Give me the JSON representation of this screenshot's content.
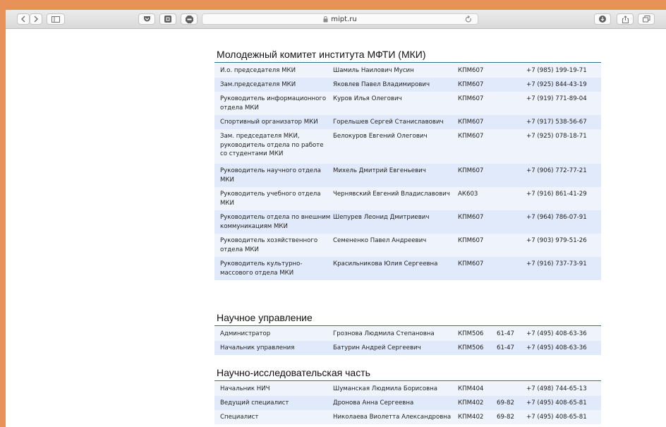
{
  "browser": {
    "url": "mipt.ru"
  },
  "sections": [
    {
      "title": "Молодежный комитет института МФТИ (МКИ)",
      "rows": [
        {
          "role": "И.о. председателя МКИ",
          "name": "Шамиль Наилович Мусин",
          "room": "КПМ607",
          "ext": "",
          "phone": "+7 (985) 199-19-71"
        },
        {
          "role": "Зам.председателя МКИ",
          "name": "Яковлев Павел Владимирович",
          "room": "КПМ607",
          "ext": "",
          "phone": "+7 (925) 844-43-19"
        },
        {
          "role": "Руководитель информационного отдела МКИ",
          "name": "Куров Илья Олегович",
          "room": "КПМ607",
          "ext": "",
          "phone": "+7 (919) 771-89-04"
        },
        {
          "role": "Спортивный организатор МКИ",
          "name": "Горельшев Сергей Станиславович",
          "room": "КПМ607",
          "ext": "",
          "phone": "+7 (917) 538-56-67"
        },
        {
          "role": "Зам. председателя МКИ, руководитель отдела по работе со студентами МКИ",
          "name": "Белокуров Евгений Олегович",
          "room": "КПМ607",
          "ext": "",
          "phone": "+7 (925) 078-18-71"
        },
        {
          "role": "Руководитель научного отдела МКИ",
          "name": "Михель Дмитрий Евгеньевич",
          "room": "КПМ607",
          "ext": "",
          "phone": "+7 (906) 772-77-21"
        },
        {
          "role": "Руководитель учебного отдела МКИ",
          "name": "Чернявский Евгений Владиславович",
          "room": "АК603",
          "ext": "",
          "phone": "+7 (916) 861-41-29"
        },
        {
          "role": "Руководитель отдела по внешним коммуникациям МКИ",
          "name": "Шепурев Леонид Дмитриевич",
          "room": "КПМ607",
          "ext": "",
          "phone": "+7 (964) 786-07-91"
        },
        {
          "role": "Руководитель хозяйственного отдела МКИ",
          "name": "Семененко Павел Андреевич",
          "room": "КПМ607",
          "ext": "",
          "phone": "+7 (903) 979-51-26"
        },
        {
          "role": "Руководитель культурно-массового отдела МКИ",
          "name": "Красильникова Юлия Сергеевна",
          "room": "КПМ607",
          "ext": "",
          "phone": "+7 (916) 737-73-91"
        }
      ]
    },
    {
      "title": "Научное управление",
      "rows": [
        {
          "role": "Администратор",
          "name": "Грознова Людмила Степановна",
          "room": "КПМ506",
          "ext": "61-47",
          "phone": "+7 (495) 408-63-36"
        },
        {
          "role": "Начальник управления",
          "name": "Батурин Андрей Сергеевич",
          "room": "КПМ506",
          "ext": "61-47",
          "phone": "+7 (495) 408-63-36"
        }
      ]
    },
    {
      "title": "Научно-исследовательская часть",
      "rows": [
        {
          "role": "Начальник НИЧ",
          "name": "Шуманская Людмила Борисовна",
          "room": "КПМ404",
          "ext": "",
          "phone": "+7 (498) 744-65-13"
        },
        {
          "role": "Ведущий специалист",
          "name": "Дронова Анна Сергеевна",
          "room": "КПМ402",
          "ext": "69-82",
          "phone": "+7 (495) 408-65-81"
        },
        {
          "role": "Специалист",
          "name": "Николаева Виолетта Александровна",
          "room": "КПМ402",
          "ext": "69-82",
          "phone": "+7 (495) 408-65-81"
        }
      ]
    }
  ]
}
